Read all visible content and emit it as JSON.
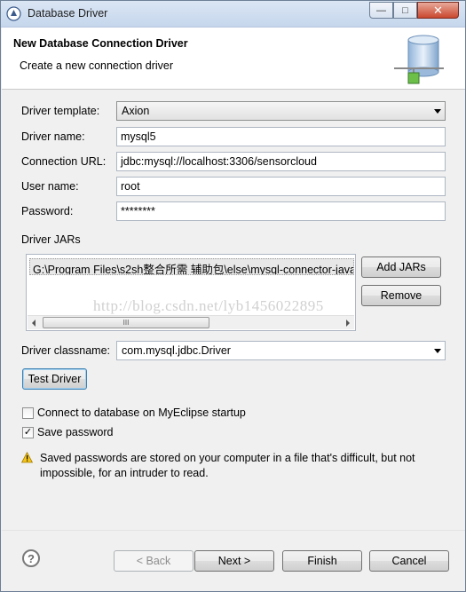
{
  "window": {
    "title": "Database Driver",
    "minimize_glyph": "—",
    "maximize_glyph": "□",
    "close_glyph": "✕"
  },
  "header": {
    "title": "New Database Connection Driver",
    "subtitle": "Create a new connection driver",
    "icon": "database-icon"
  },
  "form": {
    "driver_template": {
      "label": "Driver template:",
      "value": "Axion"
    },
    "driver_name": {
      "label": "Driver name:",
      "value": "mysql5"
    },
    "connection_url": {
      "label": "Connection URL:",
      "value": "jdbc:mysql://localhost:3306/sensorcloud"
    },
    "user_name": {
      "label": "User name:",
      "value": "root"
    },
    "password": {
      "label": "Password:",
      "value": "********"
    }
  },
  "jars": {
    "label": "Driver JARs",
    "items": [
      "G:\\Program Files\\s2sh整合所需 辅助包\\else\\mysql-connector-java"
    ],
    "scroll_grip": "III",
    "add_label": "Add JARs",
    "remove_label": "Remove"
  },
  "driver_classname": {
    "label": "Driver classname:",
    "value": "com.mysql.jdbc.Driver"
  },
  "test_driver_label": "Test Driver",
  "options": {
    "connect_on_startup": {
      "label": "Connect to database on MyEclipse startup",
      "checked": false
    },
    "save_password": {
      "label": "Save password",
      "checked": true
    }
  },
  "warning": {
    "icon": "warning-icon",
    "text": "Saved passwords are stored on your computer in a file that's difficult, but not impossible, for an intruder to read."
  },
  "footer": {
    "back_label": "< Back",
    "next_label": "Next >",
    "finish_label": "Finish",
    "cancel_label": "Cancel",
    "help_glyph": "?"
  },
  "watermark": "http://blog.csdn.net/lyb1456022895"
}
